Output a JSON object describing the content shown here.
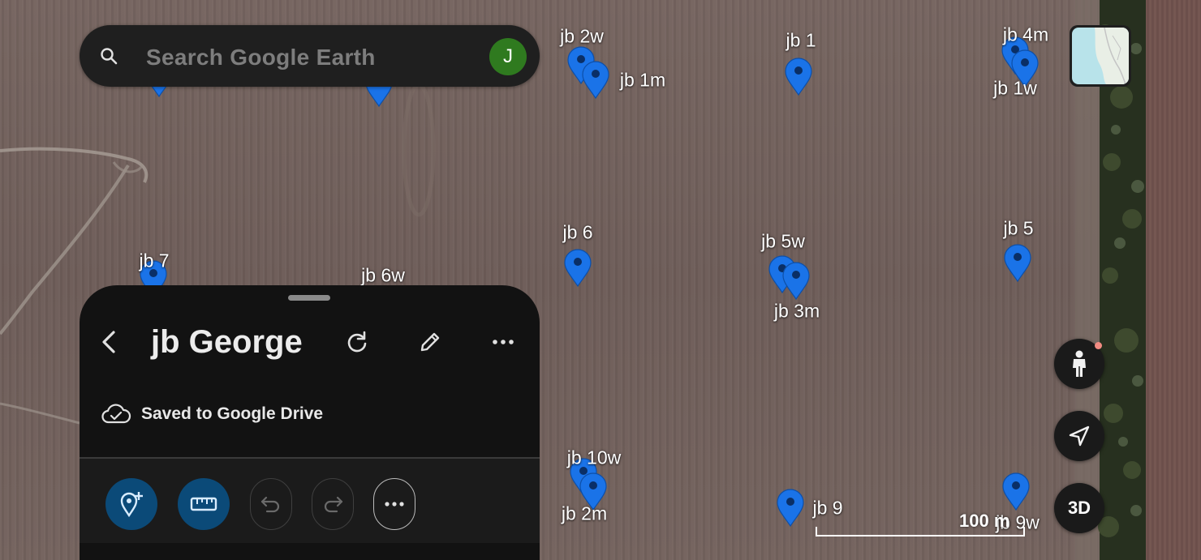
{
  "search": {
    "placeholder": "Search Google Earth",
    "avatar_initial": "J"
  },
  "map": {
    "view": "satellite",
    "placemarks": [
      {
        "label": "jb 2w"
      },
      {
        "label": "jb 1m"
      },
      {
        "label": "jb 1"
      },
      {
        "label": "jb 4m"
      },
      {
        "label": "jb 1w"
      },
      {
        "label": "jb 7"
      },
      {
        "label": "jb 6w"
      },
      {
        "label": "jb 6"
      },
      {
        "label": "jb 5w"
      },
      {
        "label": "jb 3m"
      },
      {
        "label": "jb 5"
      },
      {
        "label": "jb 10w"
      },
      {
        "label": "jb 2m"
      },
      {
        "label": "jb 9"
      },
      {
        "label": "jb 9w"
      }
    ],
    "scale": "100 m",
    "pin_color": "#1a73e8"
  },
  "project": {
    "title": "jb George",
    "status": "Saved to Google Drive"
  },
  "controls": {
    "three_d_label": "3D"
  },
  "icons": {
    "search": "search-icon",
    "back": "back-arrow-icon",
    "refresh": "refresh-icon",
    "edit": "pencil-icon",
    "more": "more-horizontal-icon",
    "cloud": "cloud-check-icon",
    "add_placemark": "add-placemark-icon",
    "ruler": "ruler-icon",
    "undo": "undo-icon",
    "redo": "redo-icon",
    "pegman": "pegman-icon",
    "location": "my-location-icon"
  }
}
